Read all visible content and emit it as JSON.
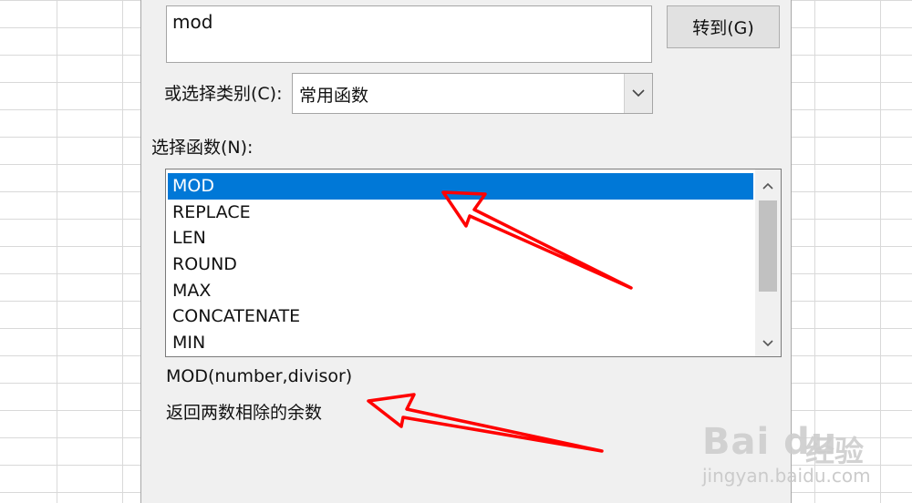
{
  "dialog": {
    "search": {
      "value": "mod"
    },
    "go_button": "转到(G)",
    "category_label": "或选择类别(C):",
    "category_value": "常用函数",
    "function_label": "选择函数(N):",
    "functions": [
      "MOD",
      "REPLACE",
      "LEN",
      "ROUND",
      "MAX",
      "CONCATENATE",
      "MIN"
    ],
    "selected_function": "MOD",
    "signature": "MOD(number,divisor)",
    "description": "返回两数相除的余数"
  },
  "watermark": {
    "logo": "Bai du",
    "brand_cn": "经验",
    "url": "jingyan.baidu.com"
  },
  "colors": {
    "selection": "#0078d7",
    "dialog_bg": "#f0f0f0",
    "annotation_arrow": "#ff0000"
  },
  "icons": [
    "chevron-down-icon",
    "scroll-up-icon",
    "scroll-down-icon",
    "arrow-annotation"
  ]
}
